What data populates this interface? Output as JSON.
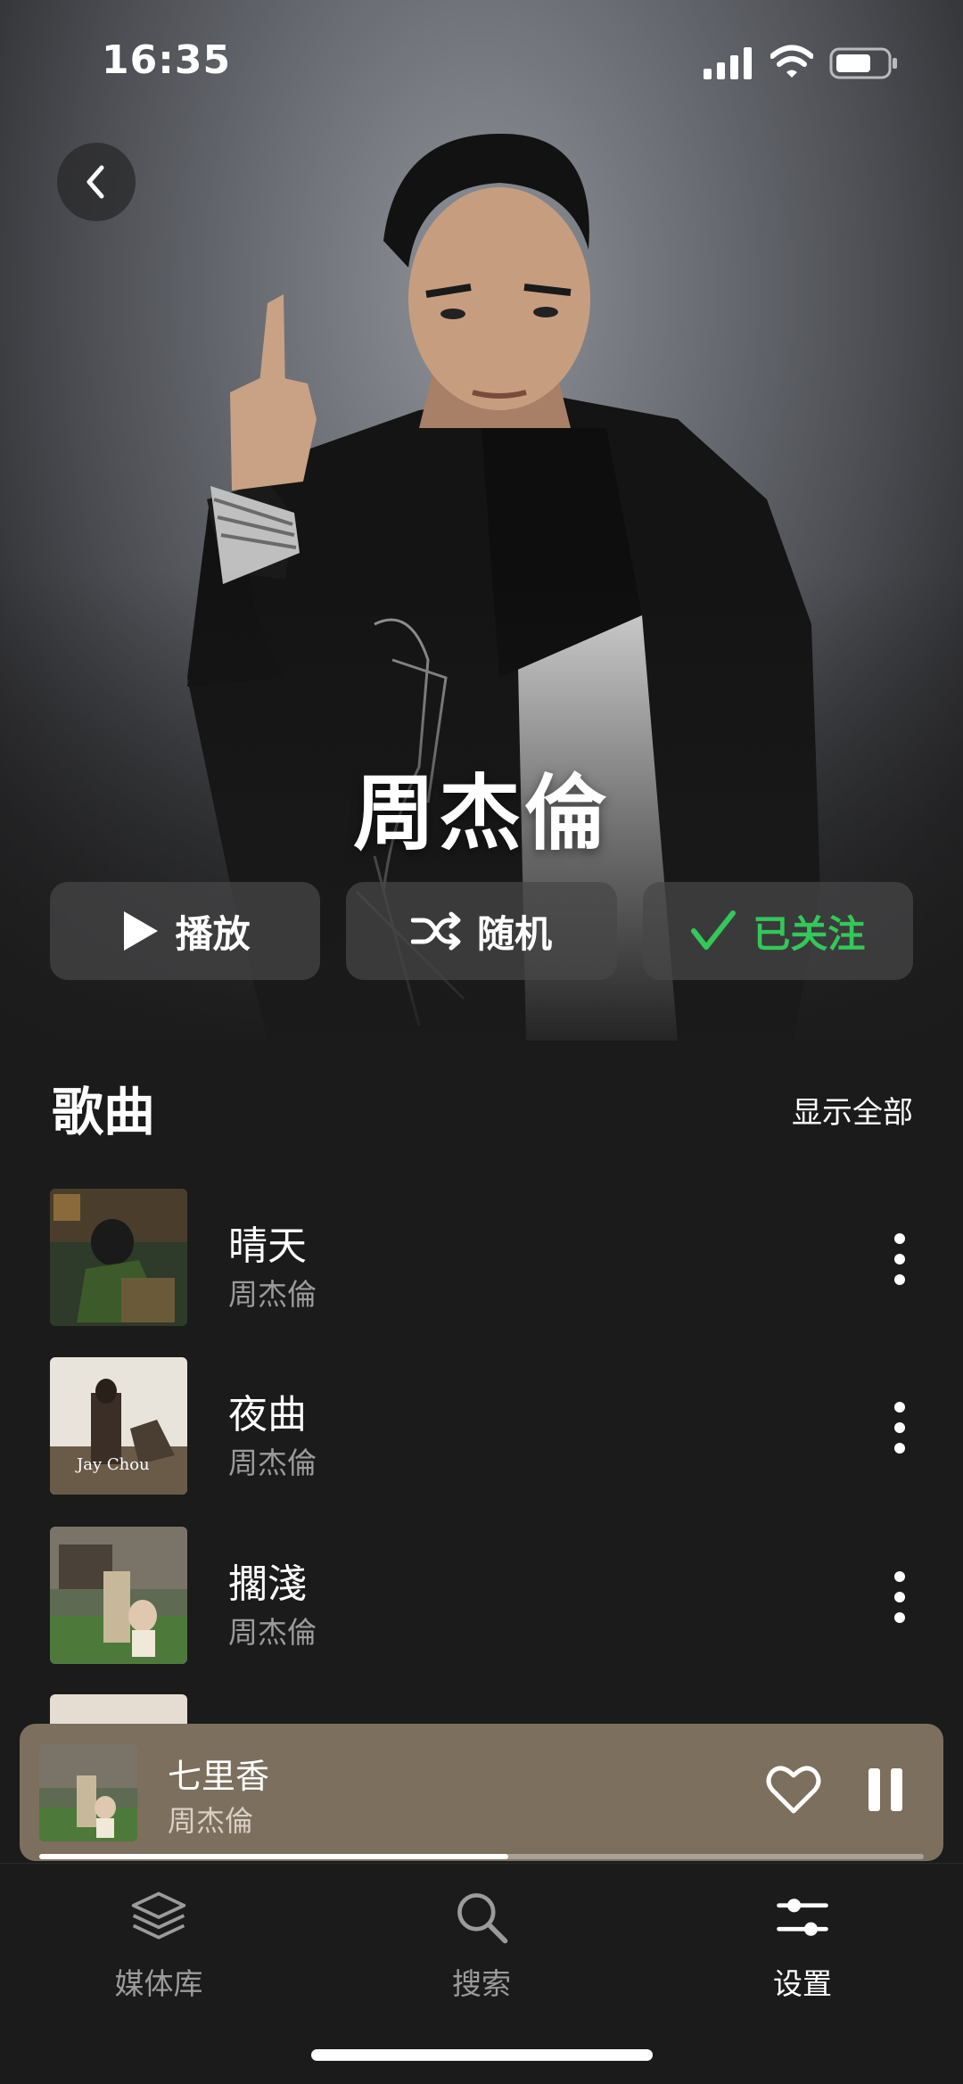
{
  "status_bar": {
    "time": "16:35"
  },
  "artist": {
    "name": "周杰倫"
  },
  "actions": {
    "play_label": "播放",
    "shuffle_label": "随机",
    "follow_label": "已关注"
  },
  "songs_section": {
    "title": "歌曲",
    "show_all_label": "显示全部"
  },
  "songs": [
    {
      "title": "晴天",
      "artist": "周杰倫"
    },
    {
      "title": "夜曲",
      "artist": "周杰倫"
    },
    {
      "title": "擱淺",
      "artist": "周杰倫"
    }
  ],
  "now_playing": {
    "title": "七里香",
    "artist": "周杰倫",
    "progress": 0.53
  },
  "tabs": [
    {
      "label": "媒体库",
      "icon": "layers-icon",
      "active": false
    },
    {
      "label": "搜索",
      "icon": "search-icon",
      "active": false
    },
    {
      "label": "设置",
      "icon": "sliders-icon",
      "active": true
    }
  ],
  "colors": {
    "accent_green": "#34c759",
    "mini_player_bg": "#7c6f5e",
    "background": "#1b1b1b"
  },
  "cover_art": {
    "album_1_text": "Jay Chou"
  }
}
